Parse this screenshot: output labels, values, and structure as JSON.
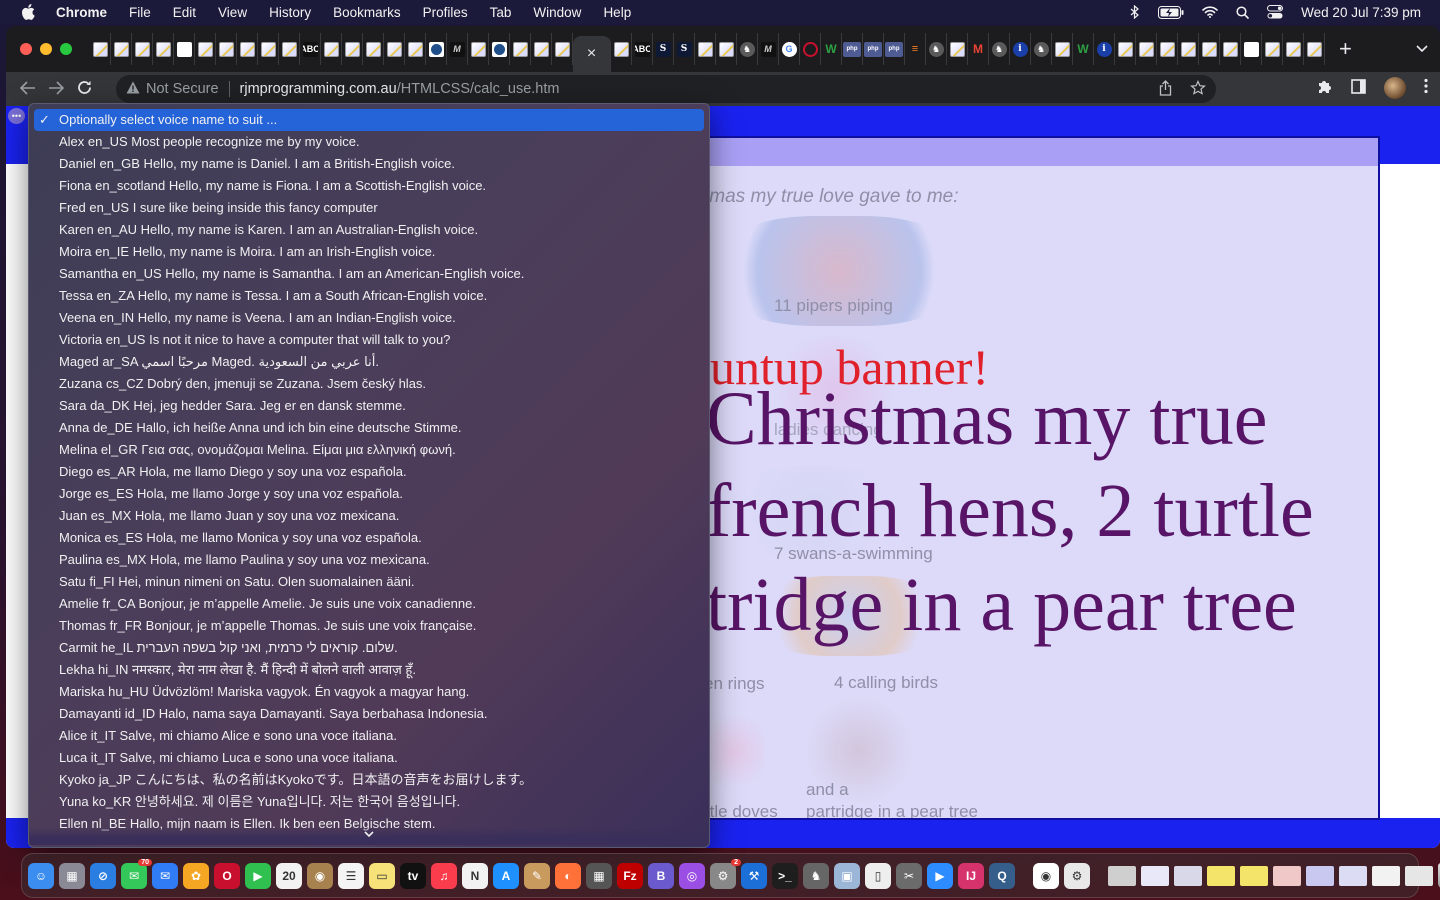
{
  "menubar": {
    "app_name": "Chrome",
    "items": [
      "File",
      "Edit",
      "View",
      "History",
      "Bookmarks",
      "Profiles",
      "Tab",
      "Window",
      "Help"
    ],
    "clock": "Wed 20 Jul  7:39 pm",
    "status_icons": [
      "bluetooth-icon",
      "battery-charging-icon",
      "wifi-icon",
      "spotlight-search-icon",
      "control-center-icon"
    ]
  },
  "browser": {
    "tabs_before_active": [
      "pencil",
      "blank-pencil",
      "pencil",
      "pencil",
      "blank",
      "pencil",
      "pencil",
      "pencil",
      "pencil",
      "pencil",
      "abc",
      "pencil",
      "pencil",
      "pencil",
      "pencil",
      "pencil",
      "circle-blue",
      "m",
      "pencil",
      "circle-blue",
      "pencil",
      "pencil",
      "pencil"
    ],
    "active_tab_close": "×",
    "tabs_after_active": [
      "pencil",
      "abc",
      "s",
      "s",
      "pencil",
      "pencil",
      "elephant",
      "m",
      "google",
      "opera",
      "w",
      "php",
      "php",
      "php",
      "so",
      "elephant",
      "pencil",
      "gmail",
      "elephant",
      "info",
      "elephant",
      "pencil",
      "w",
      "info",
      "pencil",
      "pencil",
      "pencil",
      "pencil",
      "pencil",
      "pencil",
      "blank",
      "pencil",
      "pencil",
      "blank-pencil"
    ],
    "new_tab": "+",
    "tab_search": "⌄",
    "address": {
      "security_label": "Not Secure",
      "host": "rjmprogramming.com.au",
      "path": "/HTMLCSS/calc_use.htm"
    }
  },
  "page": {
    "bg_labels": {
      "top_phrase": "tmas my true love gave to me:",
      "pipers": "11 pipers piping",
      "ladies": "ladies dancing",
      "swans": "7 swans-a-swimming",
      "rings": "en rings",
      "calling": "4 calling birds",
      "and_a": "and a",
      "partridge": "partridge in a pear tree",
      "doves": "rtle doves"
    },
    "banner_text": "untup banner!",
    "lyrics_lines": [
      "Christmas my true",
      "french hens, 2 turtle",
      "tridge in a pear tree"
    ]
  },
  "voice_select": {
    "selected_index": 0,
    "options": [
      "Optionally select voice name to suit ...",
      "Alex en_US Most people recognize me by my voice.",
      "Daniel en_GB Hello, my name is Daniel. I am a British-English voice.",
      "Fiona en_scotland Hello, my name is Fiona. I am a Scottish-English voice.",
      "Fred en_US I sure like being inside this fancy computer",
      "Karen en_AU Hello, my name is Karen. I am an Australian-English voice.",
      "Moira en_IE Hello, my name is Moira. I am an Irish-English voice.",
      "Samantha en_US Hello, my name is Samantha. I am an American-English voice.",
      "Tessa en_ZA Hello, my name is Tessa. I am a South African-English voice.",
      "Veena en_IN Hello, my name is Veena. I am an Indian-English voice.",
      "Victoria en_US Is not it nice to have a computer that will talk to you?",
      "Maged ar_SA مرحبًا اسمي Maged. أنا عربي من السعودية.",
      "Zuzana cs_CZ Dobrý den, jmenuji se Zuzana. Jsem český hlas.",
      "Sara da_DK Hej, jeg hedder Sara. Jeg er en dansk stemme.",
      "Anna de_DE Hallo, ich heiße Anna und ich bin eine deutsche Stimme.",
      "Melina el_GR Γεια σας, ονομάζομαι Melina. Είμαι μια ελληνική φωνή.",
      "Diego es_AR Hola, me llamo Diego y soy una voz española.",
      "Jorge es_ES Hola, me llamo Jorge y soy una voz española.",
      "Juan es_MX Hola, me llamo Juan y soy una voz mexicana.",
      "Monica es_ES Hola, me llamo Monica y soy una voz española.",
      "Paulina es_MX Hola, me llamo Paulina y soy una voz mexicana.",
      "Satu fi_FI Hei, minun nimeni on Satu. Olen suomalainen ääni.",
      "Amelie fr_CA Bonjour, je m’appelle Amelie. Je suis une voix canadienne.",
      "Thomas fr_FR Bonjour, je m’appelle Thomas. Je suis une voix française.",
      "Carmit he_IL שלום. קוראים לי כרמית, ואני קול בשפה העברית.",
      "Lekha hi_IN नमस्कार, मेरा नाम लेखा है. मैं हिन्दी में बोलने वाली आवाज़ हूँ.",
      "Mariska hu_HU Üdvözlöm! Mariska vagyok. Én vagyok a magyar hang.",
      "Damayanti id_ID Halo, nama saya Damayanti. Saya berbahasa Indonesia.",
      "Alice it_IT Salve, mi chiamo Alice e sono una voce italiana.",
      "Luca it_IT Salve, mi chiamo Luca e sono una voce italiana.",
      "Kyoko ja_JP こんにちは、私の名前はKyokoです。日本語の音声をお届けします。",
      "Yuna ko_KR 안녕하세요. 제 이름은 Yuna입니다. 저는 한국어 음성입니다.",
      "Ellen nl_BE Hallo, mijn naam is Ellen. Ik ben een Belgische stem."
    ],
    "check_mark": "✓",
    "scroll_down": "⌄"
  },
  "dock": {
    "apps": [
      {
        "name": "finder",
        "glyph": "☺",
        "color": "#3b8ef0"
      },
      {
        "name": "launchpad",
        "glyph": "▦",
        "color": "#8a8a96"
      },
      {
        "name": "safari",
        "glyph": "⊘",
        "color": "#2a7de1"
      },
      {
        "name": "messages",
        "glyph": "✉",
        "color": "#34c759",
        "badge": "70"
      },
      {
        "name": "mail",
        "glyph": "✉",
        "color": "#2f7cf6"
      },
      {
        "name": "photos",
        "glyph": "✿",
        "color": "#f5a623"
      },
      {
        "name": "opera",
        "glyph": "O",
        "color": "#c8102e"
      },
      {
        "name": "facetime",
        "glyph": "▶",
        "color": "#30c050"
      },
      {
        "name": "calendar",
        "glyph": "20",
        "color": "#f2f2f2"
      },
      {
        "name": "contacts",
        "glyph": "◉",
        "color": "#a8824e"
      },
      {
        "name": "reminders",
        "glyph": "☰",
        "color": "#f4f4f4"
      },
      {
        "name": "notes",
        "glyph": "▭",
        "color": "#f7e27a"
      },
      {
        "name": "apple-tv",
        "glyph": "tv",
        "color": "#111111"
      },
      {
        "name": "music",
        "glyph": "♫",
        "color": "#fa3c4c"
      },
      {
        "name": "news",
        "glyph": "N",
        "color": "#f2f2f2"
      },
      {
        "name": "app-store",
        "glyph": "A",
        "color": "#1e90ff"
      },
      {
        "name": "paintbrush",
        "glyph": "✎",
        "color": "#c99a5e"
      },
      {
        "name": "firefox",
        "glyph": "◐",
        "color": "#ff7139"
      },
      {
        "name": "calculator",
        "glyph": "▦",
        "color": "#555555"
      },
      {
        "name": "filezilla",
        "glyph": "Fz",
        "color": "#bf0000"
      },
      {
        "name": "bbedit",
        "glyph": "B",
        "color": "#6a5acd"
      },
      {
        "name": "podcasts",
        "glyph": "◎",
        "color": "#9b4ee3"
      },
      {
        "name": "system-preferences",
        "glyph": "⚙",
        "color": "#888888",
        "badge": "2"
      },
      {
        "name": "xcode",
        "glyph": "⚒",
        "color": "#1c6fd6"
      },
      {
        "name": "terminal",
        "glyph": ">_",
        "color": "#1e1e1e"
      },
      {
        "name": "mamp",
        "glyph": "♞",
        "color": "#666666"
      },
      {
        "name": "preview",
        "glyph": "▣",
        "color": "#9cb6d8"
      },
      {
        "name": "libreoffice",
        "glyph": "▯",
        "color": "#eeeeee"
      },
      {
        "name": "gimp",
        "glyph": "✂",
        "color": "#6b6b6b"
      },
      {
        "name": "zoom",
        "glyph": "▶",
        "color": "#2d8cff"
      },
      {
        "name": "intellij",
        "glyph": "IJ",
        "color": "#d6336c"
      },
      {
        "name": "quicktime",
        "glyph": "Q",
        "color": "#355f8a"
      }
    ],
    "apps_right": [
      {
        "name": "chrome",
        "glyph": "◉",
        "color": "#ffffff"
      },
      {
        "name": "automator",
        "glyph": "⚙",
        "color": "#e8e8e8"
      }
    ],
    "minimized": [
      "printer",
      "window-1",
      "window-2",
      "window-3",
      "window-4",
      "window-5",
      "window-6",
      "window-7",
      "window-8",
      "window-9"
    ],
    "trash": "trash"
  }
}
